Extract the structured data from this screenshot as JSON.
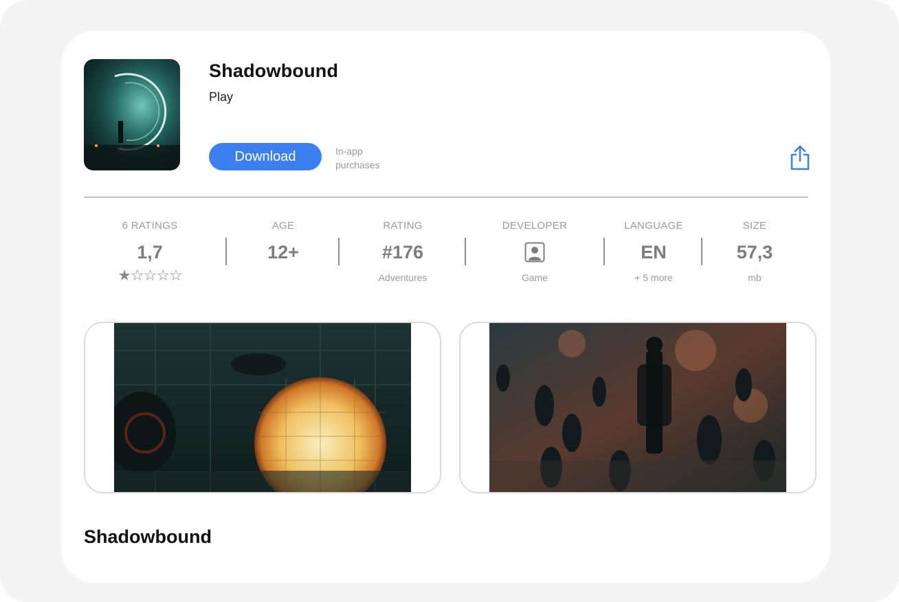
{
  "app": {
    "name": "Shadowbound",
    "subtitle": "Play",
    "download_label": "Download",
    "inapp_line1": "In-app",
    "inapp_line2": "purchases"
  },
  "stats": {
    "ratings": {
      "label": "6 RATINGS",
      "value": "1,7",
      "stars": "★☆☆☆☆",
      "stars_value": 1.7
    },
    "age": {
      "label": "AGE",
      "value": "12+"
    },
    "rating": {
      "label": "RATING",
      "value": "#176",
      "sub": "Adventures"
    },
    "developer": {
      "label": "DEVELOPER",
      "icon": "person-icon",
      "sub": "Game"
    },
    "language": {
      "label": "LANGUAGE",
      "value": "EN",
      "sub": "+ 5 more"
    },
    "size": {
      "label": "SIZE",
      "value": "57,3",
      "sub": "mb"
    }
  },
  "section": {
    "title": "Shadowbound"
  },
  "colors": {
    "accent": "#3b7ff0",
    "share_icon": "#3b7ff0",
    "divider": "#bdbdbd"
  },
  "icons": [
    "share-icon",
    "person-icon",
    "star-icon"
  ]
}
